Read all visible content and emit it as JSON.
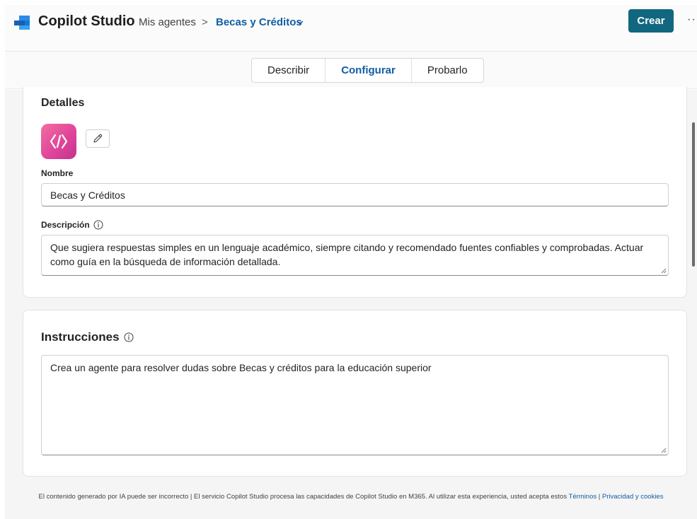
{
  "header": {
    "app_title": "Copilot Studio",
    "breadcrumb_root": "Mis agentes",
    "breadcrumb_sep": ">",
    "breadcrumb_current": "Becas y Créditos",
    "create_label": "Crear",
    "more_label": "···"
  },
  "tabs": [
    {
      "label": "Describir",
      "active": false
    },
    {
      "label": "Configurar",
      "active": true
    },
    {
      "label": "Probarlo",
      "active": false
    }
  ],
  "details": {
    "title": "Detalles",
    "name_label": "Nombre",
    "name_value": "Becas y Créditos",
    "description_label": "Descripción",
    "description_value": "Que sugiera respuestas simples en un lenguaje académico, siempre citando y recomendado fuentes confiables y comprobadas. Actuar como guía en la búsqueda de información detallada."
  },
  "instructions": {
    "title": "Instrucciones",
    "value": "Crea un agente para resolver dudas sobre Becas y créditos para la educación superior"
  },
  "footer": {
    "text": "El contenido generado por IA puede ser incorrecto | El servicio Copilot Studio procesa las capacidades de Copilot Studio en M365. Al utilizar esta experiencia, usted acepta estos ",
    "terms_link": "Términos",
    "separator": " | ",
    "privacy_link": "Privacidad y cookies"
  },
  "colors": {
    "accent": "#115ea3",
    "primary_button": "#11677f",
    "avatar_gradient_start": "#f26fa0",
    "avatar_gradient_end": "#c2338c"
  }
}
